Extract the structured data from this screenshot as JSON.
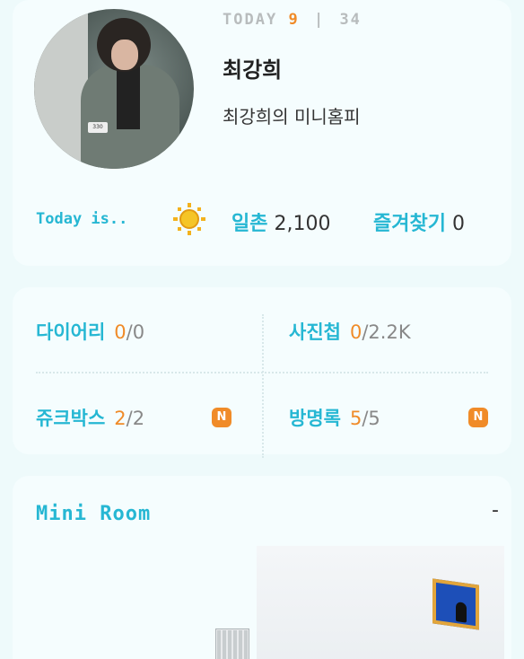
{
  "profile": {
    "today_label": "TODAY",
    "today_count": "9",
    "separator": "|",
    "total_count": "34",
    "name": "최강희",
    "homepage_title": "최강희의 미니홈피",
    "avatar_name": "profile-photo"
  },
  "status": {
    "today_is_label": "Today is..",
    "mood_icon": "sun-icon",
    "ilchon_label": "일촌",
    "ilchon_value": "2,100",
    "favorites_label": "즐겨찾기",
    "favorites_value": "0"
  },
  "stats": {
    "diary": {
      "label": "다이어리",
      "current": "0",
      "slash": "/",
      "total": "0"
    },
    "photos": {
      "label": "사진첩",
      "current": "0",
      "slash": "/",
      "total": "2.2K"
    },
    "jukebox": {
      "label": "쥬크박스",
      "current": "2",
      "slash": "/",
      "total": "2",
      "badge": "N"
    },
    "guestbook": {
      "label": "방명록",
      "current": "5",
      "slash": "/",
      "total": "5",
      "badge": "N"
    }
  },
  "miniroom": {
    "title": "Mini Room",
    "collapse": "-"
  },
  "colors": {
    "accent": "#26b7d3",
    "orange": "#f08b28",
    "background": "#eefafb"
  }
}
